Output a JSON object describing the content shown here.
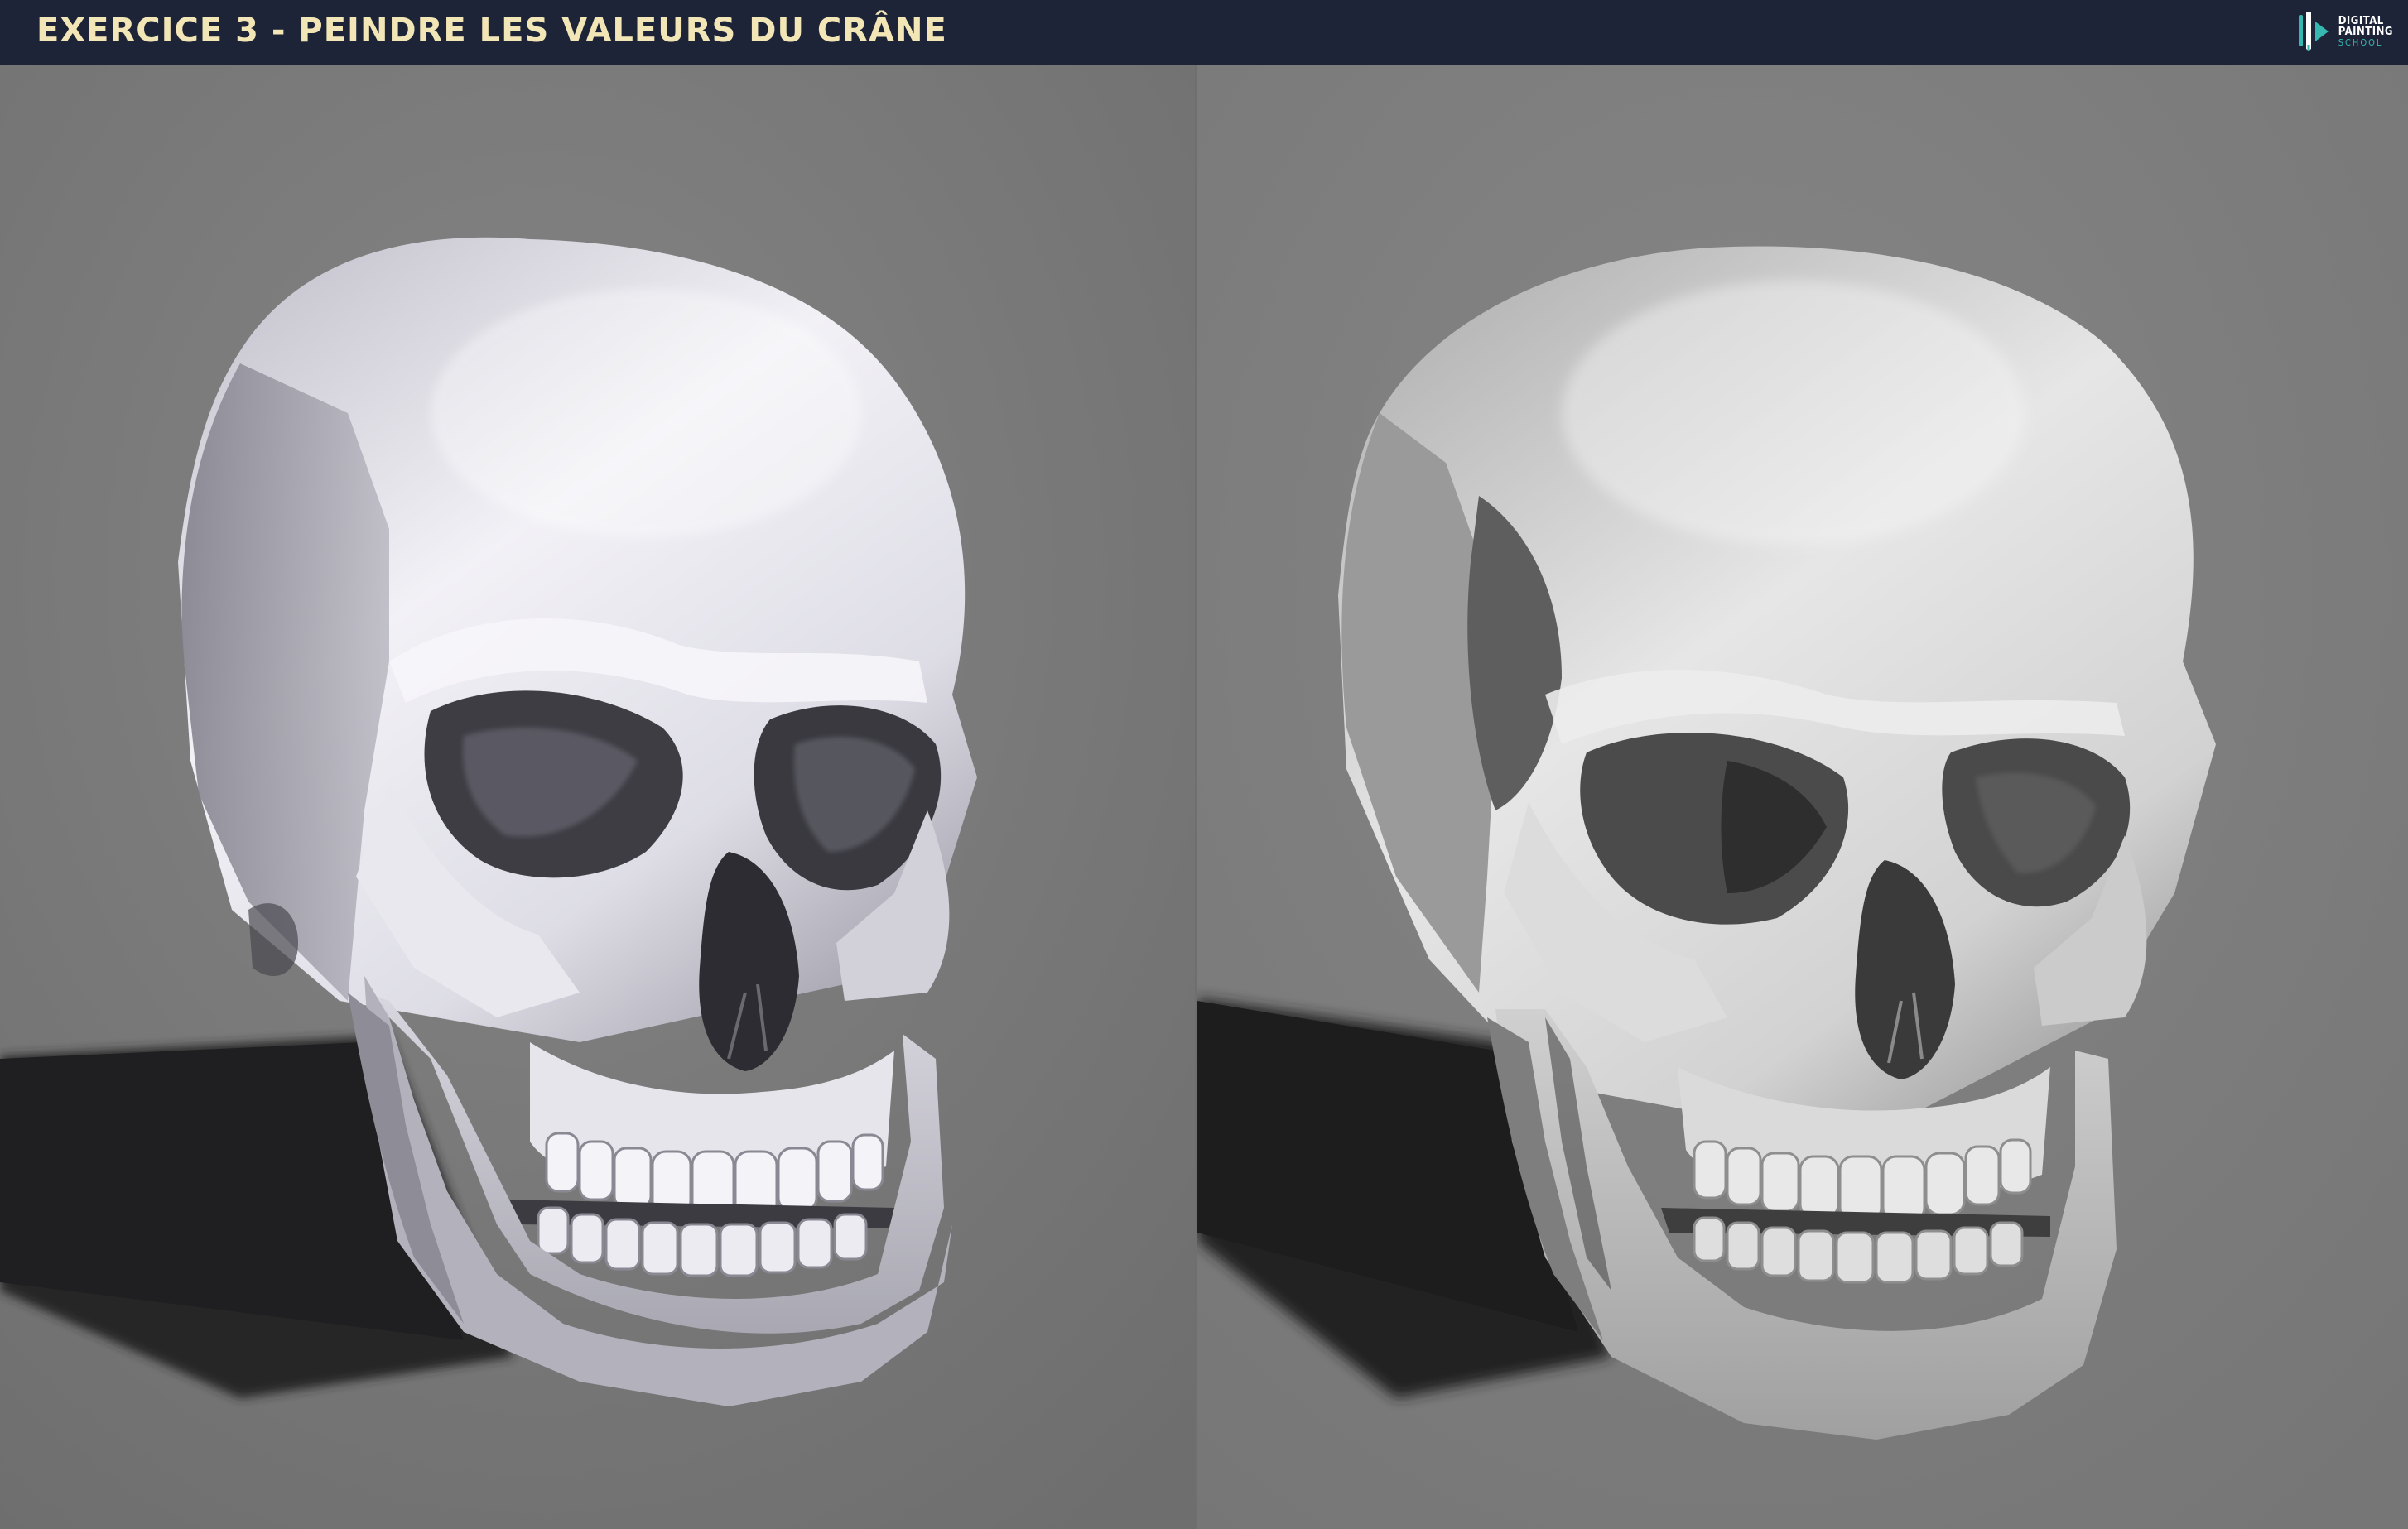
{
  "header": {
    "title": "EXERCICE 3 - PEINDRE LES VALEURS DU CRÂNE",
    "logo": {
      "line1": "DIGITAL",
      "line2": "PAINTING",
      "line3": "SCHOOL",
      "icon": "brush-palette-logo-icon"
    }
  },
  "colors": {
    "header_bg": "#1e2438",
    "title_text": "#f3e6b6",
    "logo_accent": "#36b8b0",
    "background_gray": "#7a7a7a",
    "shadow": "#2a2a2a"
  },
  "panels": [
    {
      "name": "reference-3d-render",
      "subject": "skull-reference"
    },
    {
      "name": "painted-study",
      "subject": "skull-painting"
    }
  ]
}
